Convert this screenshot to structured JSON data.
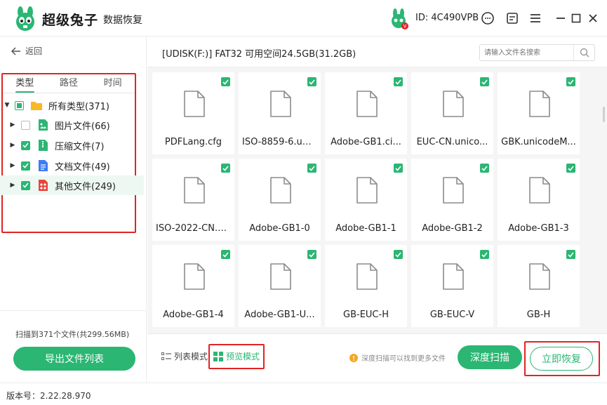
{
  "app": {
    "brand": "超级兔子",
    "brand_sub": "数据恢复",
    "user_id": "ID: 4C490VPB",
    "avatar_badge": "V"
  },
  "titlebar_icons": [
    "support-icon",
    "feedback-icon",
    "menu-icon",
    "minimize-icon",
    "maximize-icon",
    "close-icon"
  ],
  "left": {
    "back_label": "返回",
    "tabs": [
      {
        "label": "类型",
        "active": true
      },
      {
        "label": "路径",
        "active": false
      },
      {
        "label": "时间",
        "active": false
      }
    ],
    "tree": [
      {
        "label": "所有类型(371)",
        "check": "partial",
        "icon": "folder-icon",
        "expanded": true,
        "level": 0
      },
      {
        "label": "图片文件(66)",
        "check": "off",
        "icon": "image-file-icon",
        "level": 1
      },
      {
        "label": "压缩文件(7)",
        "check": "on",
        "icon": "archive-file-icon",
        "level": 1
      },
      {
        "label": "文档文件(49)",
        "check": "on",
        "icon": "document-file-icon",
        "level": 1
      },
      {
        "label": "其他文件(249)",
        "check": "on",
        "icon": "other-file-icon",
        "level": 1,
        "selected": true
      }
    ],
    "scan_summary": "扫描到371个文件(共299.56MB)",
    "export_label": "导出文件列表"
  },
  "main": {
    "path": "[UDISK(F:)] FAT32 可用空间24.5GB(31.2GB)",
    "search_placeholder": "请输入文件名搜索",
    "files": [
      "PDFLang.cfg",
      "ISO-8859-6.uni...",
      "Adobe-GB1.ci...",
      "EUC-CN.unico...",
      "GBK.unicodeM...",
      "ISO-2022-CN.u...",
      "Adobe-GB1-0",
      "Adobe-GB1-1",
      "Adobe-GB1-2",
      "Adobe-GB1-3",
      "Adobe-GB1-4",
      "Adobe-GB1-U...",
      "GB-EUC-H",
      "GB-EUC-V",
      "GB-H"
    ],
    "list_mode_label": "列表模式",
    "preview_mode_label": "预览模式",
    "hint": "深度扫描可以找到更多文件",
    "deep_scan_label": "深度扫描",
    "recover_label": "立即恢复"
  },
  "version": "版本号：2.22.28.970",
  "colors": {
    "accent": "#2bb673",
    "highlight": "#e02424"
  }
}
